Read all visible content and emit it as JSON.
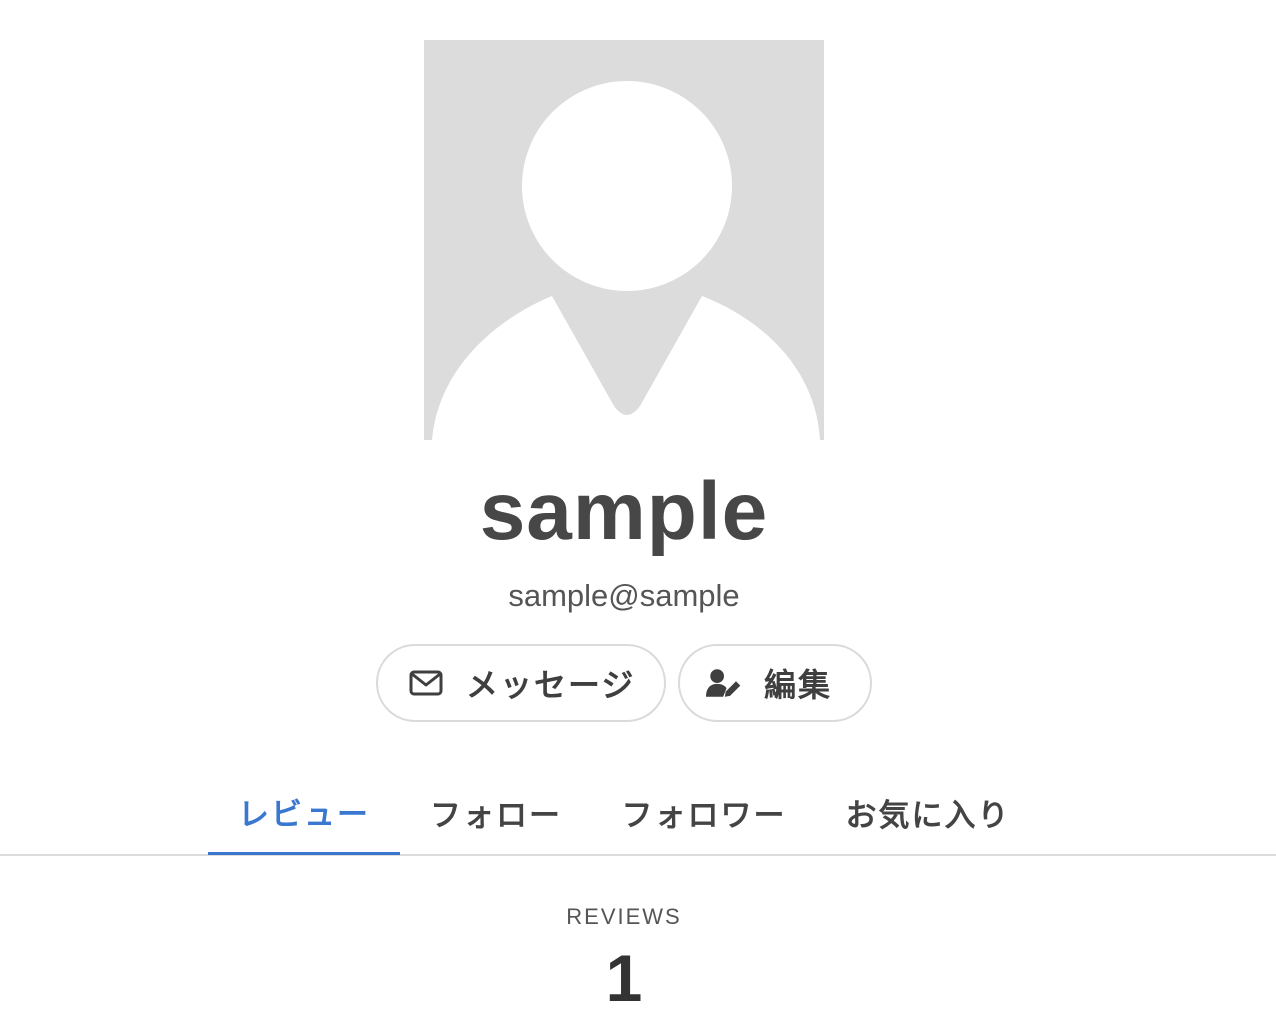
{
  "profile": {
    "username": "sample",
    "email": "sample@sample",
    "avatar_icon": "default-user-avatar-icon"
  },
  "actions": {
    "message_label": "メッセージ",
    "message_icon": "envelope-icon",
    "edit_label": "編集",
    "edit_icon": "user-edit-icon"
  },
  "tabs": [
    {
      "label": "レビュー",
      "active": true
    },
    {
      "label": "フォロー",
      "active": false
    },
    {
      "label": "フォロワー",
      "active": false
    },
    {
      "label": "お気に入り",
      "active": false
    }
  ],
  "stats": {
    "label": "REVIEWS",
    "value": "1"
  },
  "colors": {
    "accent": "#3a77d0",
    "avatar_bg": "#dcdcdc",
    "text": "#444444"
  }
}
